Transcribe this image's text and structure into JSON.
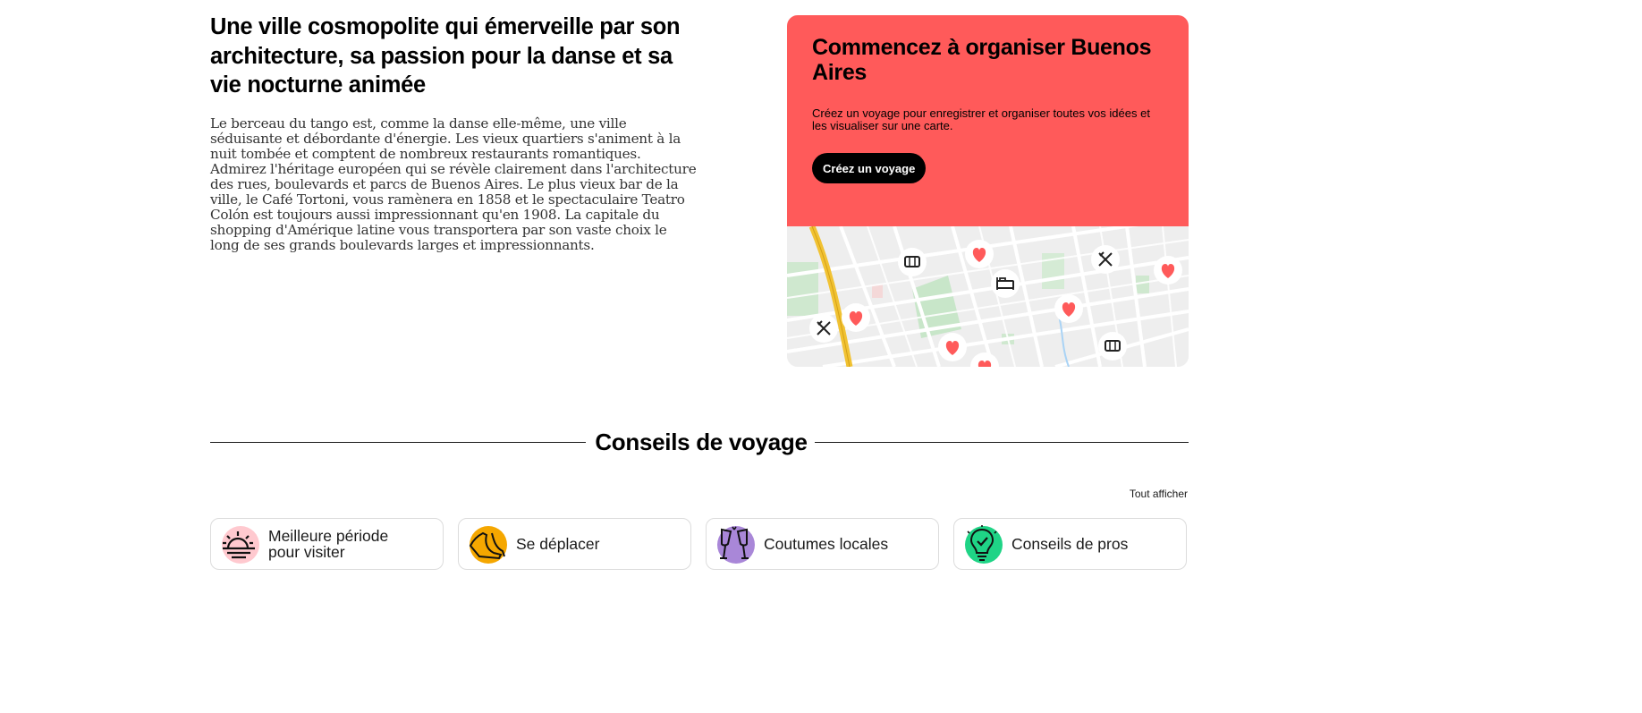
{
  "intro": {
    "title": "Une ville cosmopolite qui émerveille par son architecture, sa passion pour la danse et sa vie nocturne animée",
    "body": "Le berceau du tango est, comme la danse elle-même, une ville séduisante et débordante d'énergie. Les vieux quartiers s'animent à la nuit tombée et comptent de nombreux restaurants romantiques. Admirez l'héritage européen qui se révèle clairement dans l'architecture des rues, boulevards et parcs de Buenos Aires. Le plus vieux bar de la ville, le Café Tortoni, vous ramènera en 1858 et le spectaculaire Teatro Colón est toujours aussi impressionnant qu'en 1908. La capitale du shopping d'Amérique latine vous transportera par son vaste choix le long de ses grands boulevards larges et impressionnants."
  },
  "trip_card": {
    "title": "Commencez à organiser Buenos Aires",
    "description": "Créez un voyage pour enregistrer et organiser toutes vos idées et les visualiser sur une carte.",
    "button_label": "Créez un voyage",
    "background_color": "#ff5a5a"
  },
  "map_pins": [
    {
      "type": "ticket-icon"
    },
    {
      "type": "heart-icon"
    },
    {
      "type": "restaurant-icon"
    },
    {
      "type": "heart-icon"
    },
    {
      "type": "hotel-icon"
    },
    {
      "type": "heart-icon"
    },
    {
      "type": "restaurant-icon"
    },
    {
      "type": "heart-icon"
    },
    {
      "type": "heart-icon"
    },
    {
      "type": "ticket-icon"
    },
    {
      "type": "heart-icon"
    }
  ],
  "tips_section": {
    "title": "Conseils de voyage",
    "see_all": "Tout afficher",
    "items": [
      {
        "label": "Meilleure période pour visiter",
        "icon": "sunrise-icon",
        "color": "#ffc9cf"
      },
      {
        "label": "Se déplacer",
        "icon": "shoes-icon",
        "color": "#f5a700"
      },
      {
        "label": "Coutumes locales",
        "icon": "cheers-icon",
        "color": "#a987d8"
      },
      {
        "label": "Conseils de pros",
        "icon": "lightbulb-icon",
        "color": "#1fd486"
      }
    ]
  }
}
